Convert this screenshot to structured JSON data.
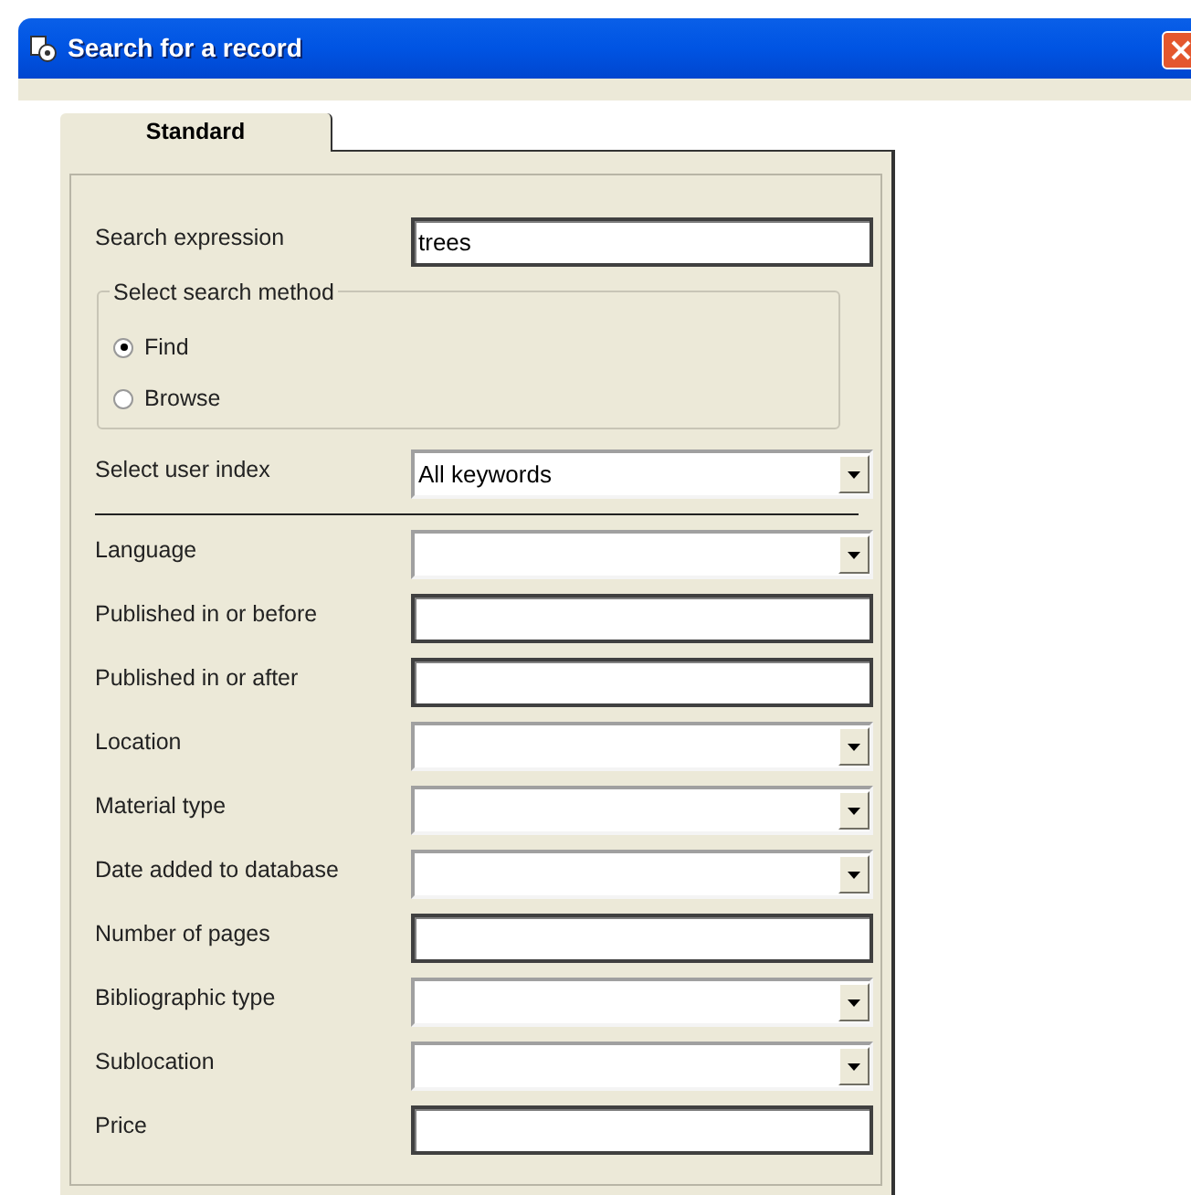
{
  "window": {
    "title": "Search for a record"
  },
  "tabs": [
    {
      "label": "Standard",
      "selected": true
    }
  ],
  "search_expression": {
    "label": "Search expression",
    "value": "trees"
  },
  "search_method": {
    "title": "Select search method",
    "options": [
      {
        "label": "Find",
        "selected": true
      },
      {
        "label": "Browse",
        "selected": false
      }
    ]
  },
  "user_index": {
    "label": "Select user index",
    "value": "All keywords"
  },
  "fields": [
    {
      "label": "Language",
      "kind": "dropdown"
    },
    {
      "label": "Published in or before",
      "kind": "text"
    },
    {
      "label": "Published in or after",
      "kind": "text"
    },
    {
      "label": "Location",
      "kind": "dropdown"
    },
    {
      "label": "Material type",
      "kind": "dropdown"
    },
    {
      "label": "Date added to database",
      "kind": "dropdown"
    },
    {
      "label": "Number of pages",
      "kind": "text"
    },
    {
      "label": "Bibliographic type",
      "kind": "dropdown"
    },
    {
      "label": "Sublocation",
      "kind": "dropdown"
    },
    {
      "label": "Price",
      "kind": "text"
    }
  ]
}
